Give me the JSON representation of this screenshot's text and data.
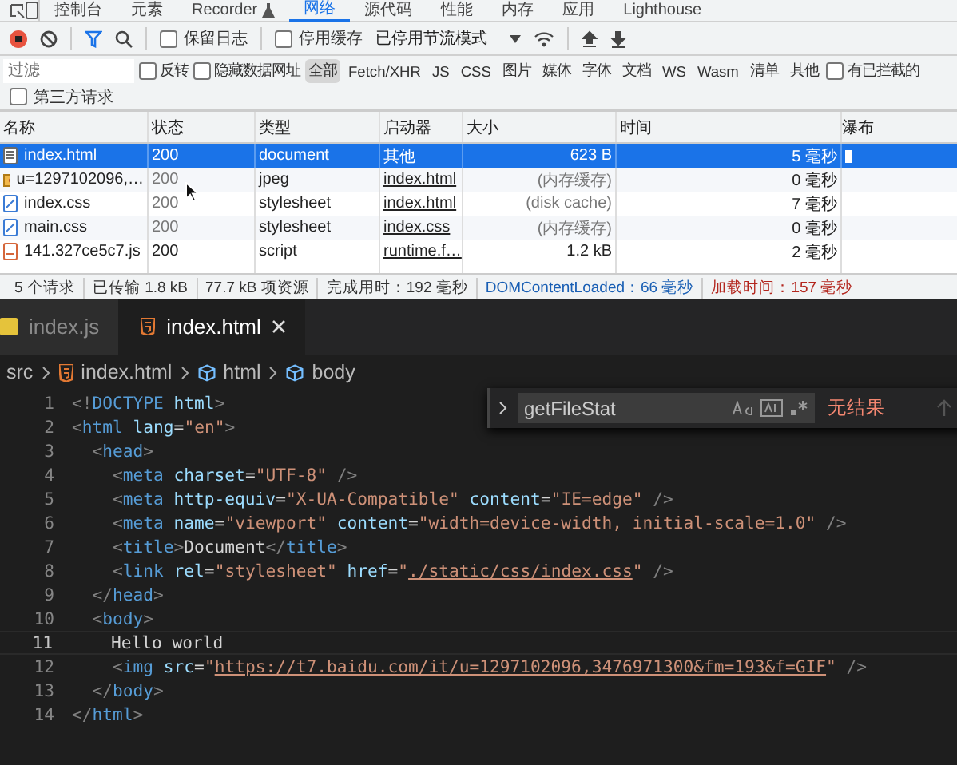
{
  "devtools": {
    "panel_tabs": [
      {
        "label": "控制台",
        "kind": "plain",
        "selected": false
      },
      {
        "label": "元素",
        "kind": "plain",
        "selected": false
      },
      {
        "label": "Recorder",
        "kind": "beta",
        "selected": false
      },
      {
        "label": "网络",
        "kind": "plain",
        "selected": true
      },
      {
        "label": "源代码",
        "kind": "plain",
        "selected": false
      },
      {
        "label": "性能",
        "kind": "plain",
        "selected": false
      },
      {
        "label": "内存",
        "kind": "plain",
        "selected": false
      },
      {
        "label": "应用",
        "kind": "plain",
        "selected": false
      },
      {
        "label": "Lighthouse",
        "kind": "plain",
        "selected": false
      }
    ],
    "toolbar": {
      "recording": true,
      "preserve_log": {
        "label": "保留日志",
        "checked": false
      },
      "disable_cache": {
        "label": "停用缓存",
        "checked": false
      },
      "throttling": "已停用节流模式"
    },
    "filter": {
      "placeholder": "过滤",
      "invert": {
        "label": "反转",
        "checked": false
      },
      "hide_data_urls": {
        "label": "隐藏数据网址",
        "checked": false
      },
      "types": [
        {
          "label": "全部",
          "selected": true
        },
        {
          "label": "Fetch/XHR",
          "selected": false
        },
        {
          "label": "JS",
          "selected": false
        },
        {
          "label": "CSS",
          "selected": false
        },
        {
          "label": "图片",
          "selected": false
        },
        {
          "label": "媒体",
          "selected": false
        },
        {
          "label": "字体",
          "selected": false
        },
        {
          "label": "文档",
          "selected": false
        },
        {
          "label": "WS",
          "selected": false
        },
        {
          "label": "Wasm",
          "selected": false
        },
        {
          "label": "清单",
          "selected": false
        },
        {
          "label": "其他",
          "selected": false
        }
      ],
      "blocked": {
        "label": "有已拦截的",
        "checked": false
      },
      "third_party": {
        "label": "第三方请求",
        "checked": false
      }
    },
    "table": {
      "columns": [
        "名称",
        "状态",
        "类型",
        "启动器",
        "大小",
        "时间",
        "瀑布"
      ],
      "rows": [
        {
          "name": "index.html",
          "kind": "doc",
          "status": "200",
          "type": "document",
          "initiator": "其他",
          "initiator_link": false,
          "size": "623 B",
          "time": "5 毫秒",
          "cached": false,
          "selected": true
        },
        {
          "name": "u=1297102096,…",
          "kind": "image",
          "status": "200",
          "type": "jpeg",
          "initiator": "index.html",
          "initiator_link": true,
          "size": "(内存缓存)",
          "time": "0 毫秒",
          "cached": true,
          "selected": false
        },
        {
          "name": "index.css",
          "kind": "css",
          "status": "200",
          "type": "stylesheet",
          "initiator": "index.html",
          "initiator_link": true,
          "size": "(disk cache)",
          "time": "7 毫秒",
          "cached": true,
          "selected": false
        },
        {
          "name": "main.css",
          "kind": "css",
          "status": "200",
          "type": "stylesheet",
          "initiator": "index.css",
          "initiator_link": true,
          "size": "(内存缓存)",
          "time": "0 毫秒",
          "cached": true,
          "selected": false
        },
        {
          "name": "141.327ce5c7.js",
          "kind": "js",
          "status": "200",
          "type": "script",
          "initiator": "runtime.f…",
          "initiator_link": true,
          "size": "1.2 kB",
          "time": "2 毫秒",
          "cached": false,
          "selected": false
        }
      ]
    },
    "status_bar": [
      {
        "text": "5 个请求",
        "kind": "plain"
      },
      {
        "text": "已传输 1.8 kB",
        "kind": "plain"
      },
      {
        "text": "77.7 kB 项资源",
        "kind": "plain"
      },
      {
        "text": "完成用时：192 毫秒",
        "kind": "plain"
      },
      {
        "text": "DOMContentLoaded：66 毫秒",
        "kind": "dom"
      },
      {
        "text": "加载时间：157 毫秒",
        "kind": "load"
      }
    ]
  },
  "editor": {
    "tabs": [
      {
        "label": "index.js",
        "kind": "js",
        "selected": false
      },
      {
        "label": "index.html",
        "kind": "html",
        "selected": true
      }
    ],
    "breadcrumb": [
      {
        "label": "src",
        "kind": "folder"
      },
      {
        "label": "index.html",
        "kind": "html"
      },
      {
        "label": "html",
        "kind": "element"
      },
      {
        "label": "body",
        "kind": "element"
      }
    ],
    "find": {
      "value": "getFileStat",
      "result": "无结果"
    },
    "lines": [
      {
        "number": "1",
        "current": false,
        "tokens": [
          {
            "kind": "punct",
            "text": "<!"
          },
          {
            "kind": "tag",
            "text": "DOCTYPE"
          },
          {
            "kind": "attr",
            "text": " html"
          },
          {
            "kind": "punct",
            "text": ">"
          }
        ]
      },
      {
        "number": "2",
        "current": false,
        "tokens": [
          {
            "kind": "punct",
            "text": "<"
          },
          {
            "kind": "tag",
            "text": "html"
          },
          {
            "kind": "attr",
            "text": " lang"
          },
          {
            "kind": "text",
            "text": "="
          },
          {
            "kind": "str",
            "text": "\"en\""
          },
          {
            "kind": "punct",
            "text": ">"
          }
        ]
      },
      {
        "number": "3",
        "current": false,
        "tokens": [
          {
            "kind": "punct",
            "text": "  <"
          },
          {
            "kind": "tag",
            "text": "head"
          },
          {
            "kind": "punct",
            "text": ">"
          }
        ]
      },
      {
        "number": "4",
        "current": false,
        "tokens": [
          {
            "kind": "punct",
            "text": "    <"
          },
          {
            "kind": "tag",
            "text": "meta"
          },
          {
            "kind": "attr",
            "text": " charset"
          },
          {
            "kind": "text",
            "text": "="
          },
          {
            "kind": "str",
            "text": "\"UTF-8\""
          },
          {
            "kind": "punct",
            "text": " />"
          }
        ]
      },
      {
        "number": "5",
        "current": false,
        "tokens": [
          {
            "kind": "punct",
            "text": "    <"
          },
          {
            "kind": "tag",
            "text": "meta"
          },
          {
            "kind": "attr",
            "text": " http-equiv"
          },
          {
            "kind": "text",
            "text": "="
          },
          {
            "kind": "str",
            "text": "\"X-UA-Compatible\""
          },
          {
            "kind": "attr",
            "text": " content"
          },
          {
            "kind": "text",
            "text": "="
          },
          {
            "kind": "str",
            "text": "\"IE=edge\""
          },
          {
            "kind": "punct",
            "text": " />"
          }
        ]
      },
      {
        "number": "6",
        "current": false,
        "tokens": [
          {
            "kind": "punct",
            "text": "    <"
          },
          {
            "kind": "tag",
            "text": "meta"
          },
          {
            "kind": "attr",
            "text": " name"
          },
          {
            "kind": "text",
            "text": "="
          },
          {
            "kind": "str",
            "text": "\"viewport\""
          },
          {
            "kind": "attr",
            "text": " content"
          },
          {
            "kind": "text",
            "text": "="
          },
          {
            "kind": "str",
            "text": "\"width=device-width, initial-scale=1.0\""
          },
          {
            "kind": "punct",
            "text": " />"
          }
        ]
      },
      {
        "number": "7",
        "current": false,
        "tokens": [
          {
            "kind": "punct",
            "text": "    <"
          },
          {
            "kind": "tag",
            "text": "title"
          },
          {
            "kind": "punct",
            "text": ">"
          },
          {
            "kind": "text",
            "text": "Document"
          },
          {
            "kind": "punct",
            "text": "</"
          },
          {
            "kind": "tag",
            "text": "title"
          },
          {
            "kind": "punct",
            "text": ">"
          }
        ]
      },
      {
        "number": "8",
        "current": false,
        "tokens": [
          {
            "kind": "punct",
            "text": "    <"
          },
          {
            "kind": "tag",
            "text": "link"
          },
          {
            "kind": "attr",
            "text": " rel"
          },
          {
            "kind": "text",
            "text": "="
          },
          {
            "kind": "str",
            "text": "\"stylesheet\""
          },
          {
            "kind": "attr",
            "text": " href"
          },
          {
            "kind": "text",
            "text": "="
          },
          {
            "kind": "str",
            "text": "\""
          },
          {
            "kind": "link",
            "text": "./static/css/index.css"
          },
          {
            "kind": "str",
            "text": "\""
          },
          {
            "kind": "punct",
            "text": " />"
          }
        ]
      },
      {
        "number": "9",
        "current": false,
        "tokens": [
          {
            "kind": "punct",
            "text": "  </"
          },
          {
            "kind": "tag",
            "text": "head"
          },
          {
            "kind": "punct",
            "text": ">"
          }
        ]
      },
      {
        "number": "10",
        "current": false,
        "tokens": [
          {
            "kind": "punct",
            "text": "  <"
          },
          {
            "kind": "tag",
            "text": "body"
          },
          {
            "kind": "punct",
            "text": ">"
          }
        ]
      },
      {
        "number": "11",
        "current": true,
        "tokens": [
          {
            "kind": "text",
            "text": "    Hello world"
          }
        ]
      },
      {
        "number": "12",
        "current": false,
        "tokens": [
          {
            "kind": "punct",
            "text": "    <"
          },
          {
            "kind": "tag",
            "text": "img"
          },
          {
            "kind": "attr",
            "text": " src"
          },
          {
            "kind": "text",
            "text": "="
          },
          {
            "kind": "str",
            "text": "\""
          },
          {
            "kind": "link",
            "text": "https://t7.baidu.com/it/u=1297102096,3476971300&fm=193&f=GIF"
          },
          {
            "kind": "str",
            "text": "\""
          },
          {
            "kind": "punct",
            "text": " />"
          }
        ]
      },
      {
        "number": "13",
        "current": false,
        "tokens": [
          {
            "kind": "punct",
            "text": "  </"
          },
          {
            "kind": "tag",
            "text": "body"
          },
          {
            "kind": "punct",
            "text": ">"
          }
        ]
      },
      {
        "number": "14",
        "current": false,
        "tokens": [
          {
            "kind": "punct",
            "text": "</"
          },
          {
            "kind": "tag",
            "text": "html"
          },
          {
            "kind": "punct",
            "text": ">"
          }
        ]
      }
    ]
  }
}
